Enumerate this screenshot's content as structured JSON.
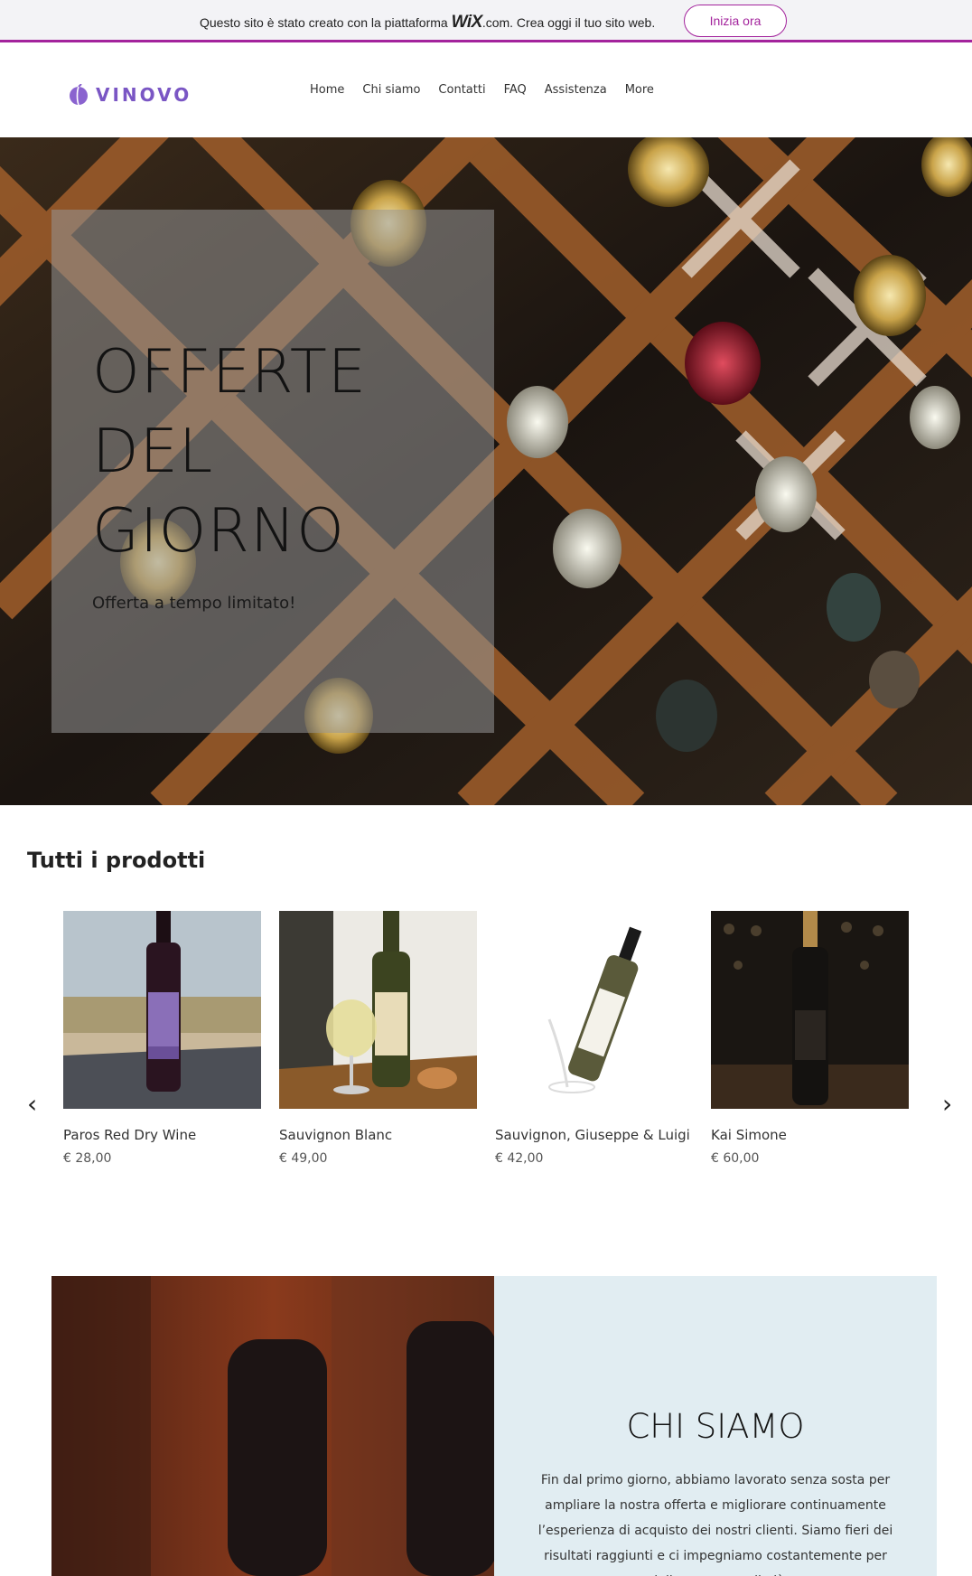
{
  "banner": {
    "text_before": "Questo sito è stato creato con la piattaforma ",
    "wix_logo": "WiX",
    "text_after": ".com. Crea oggi il tuo sito web.",
    "cta_label": "Inizia ora",
    "accent_color": "#a3239c"
  },
  "header": {
    "brand_name": "VINOVO",
    "brand_color": "#7a56c4",
    "nav": [
      {
        "label": "Home"
      },
      {
        "label": "Chi siamo"
      },
      {
        "label": "Contatti"
      },
      {
        "label": "FAQ"
      },
      {
        "label": "Assistenza"
      },
      {
        "label": "More"
      }
    ]
  },
  "hero": {
    "title_lines": [
      "OFFERTE",
      "DEL",
      "GIORNO"
    ],
    "subtitle": "Offerta a tempo limitato!"
  },
  "products": {
    "section_title": "Tutti i prodotti",
    "prev_icon": "chevron-left-icon",
    "next_icon": "chevron-right-icon",
    "items": [
      {
        "name": "Paros Red Dry Wine",
        "price": "€ 28,00"
      },
      {
        "name": "Sauvignon Blanc",
        "price": "€ 49,00"
      },
      {
        "name": "Sauvignon, Giuseppe & Luigi",
        "price": "€ 42,00"
      },
      {
        "name": "Kai Simone",
        "price": "€ 60,00"
      }
    ]
  },
  "about": {
    "title": "CHI SIAMO",
    "text": "Fin dal primo giorno, abbiamo lavorato senza sosta per ampliare la nostra offerta e migliorare continuamente l’esperienza di acquisto dei nostri clienti. Siamo fieri dei risultati raggiunti e ci impegniamo costantemente per migliorare ancor di più."
  }
}
